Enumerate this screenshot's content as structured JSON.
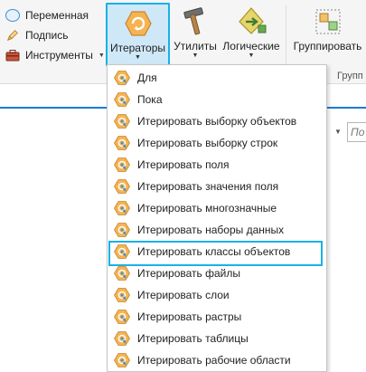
{
  "ribbon": {
    "small_buttons": [
      {
        "label": "Переменная",
        "icon": "ellipse-variable-icon"
      },
      {
        "label": "Подпись",
        "icon": "pencil-label-icon"
      },
      {
        "label": "Инструменты",
        "icon": "toolbox-icon"
      }
    ],
    "iterators_label": "Итераторы",
    "utilities_label": "Утилиты",
    "logical_label": "Логические",
    "group_label": "Группировать",
    "group_section_label": "Групп"
  },
  "search": {
    "placeholder_fragment": "По"
  },
  "menu": {
    "items": [
      {
        "label": "Для"
      },
      {
        "label": "Пока"
      },
      {
        "label": "Итерировать выборку объектов"
      },
      {
        "label": "Итерировать выборку строк"
      },
      {
        "label": "Итерировать поля"
      },
      {
        "label": "Итерировать значения поля"
      },
      {
        "label": "Итерировать многозначные"
      },
      {
        "label": "Итерировать наборы данных"
      },
      {
        "label": "Итерировать классы объектов",
        "highlighted": true
      },
      {
        "label": "Итерировать файлы"
      },
      {
        "label": "Итерировать слои"
      },
      {
        "label": "Итерировать растры"
      },
      {
        "label": "Итерировать таблицы"
      },
      {
        "label": "Итерировать рабочие области"
      }
    ]
  },
  "colors": {
    "accent_highlight": "#1ab0e8",
    "iterator_fill": "#cfe8f8",
    "icon_orange": "#f5b352",
    "icon_blue": "#3a8fd1",
    "workspace_blue": "#1a7bd6"
  }
}
